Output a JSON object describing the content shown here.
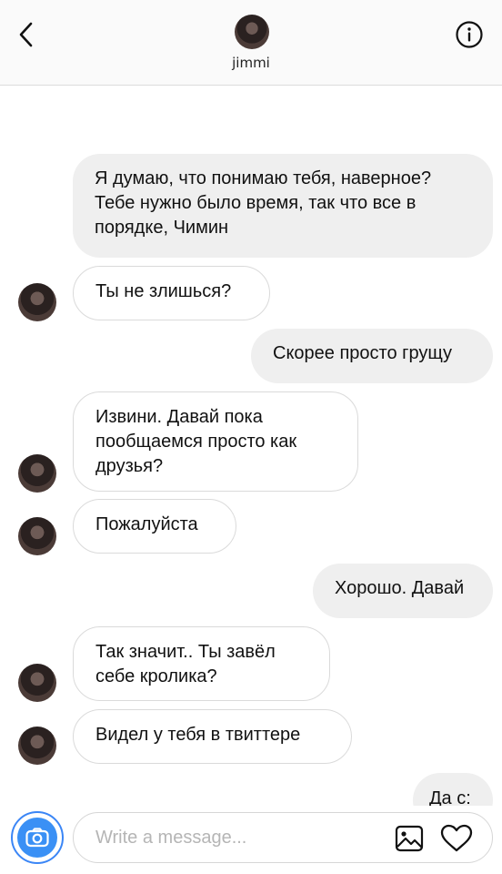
{
  "header": {
    "name": "jimmi",
    "back_icon": "chevron-left-icon",
    "info_icon": "info-icon"
  },
  "messages": [
    {
      "side": "out",
      "text": "Я думаю, что понимаю тебя, наверное? Тебе нужно было время, так что все в порядке, Чимин"
    },
    {
      "side": "in",
      "text": "Ты не злишься?"
    },
    {
      "side": "out",
      "text": "Скорее просто грущу"
    },
    {
      "side": "in",
      "text": "Извини. Давай пока пообщаемся просто как друзья?"
    },
    {
      "side": "in",
      "text": "Пожалуйста"
    },
    {
      "side": "out",
      "text": "Хорошо. Давай"
    },
    {
      "side": "in",
      "text": "Так значит.. Ты завёл себе кролика?"
    },
    {
      "side": "in",
      "text": "Видел у тебя в твиттере"
    },
    {
      "side": "out",
      "text": "Да с:"
    }
  ],
  "composer": {
    "placeholder": "Write a message...",
    "camera_icon": "camera-icon",
    "gallery_icon": "image-icon",
    "like_icon": "heart-icon"
  },
  "colors": {
    "accent": "#3a90f5",
    "outgoing_bubble": "#efefef",
    "incoming_border": "#dadada"
  }
}
